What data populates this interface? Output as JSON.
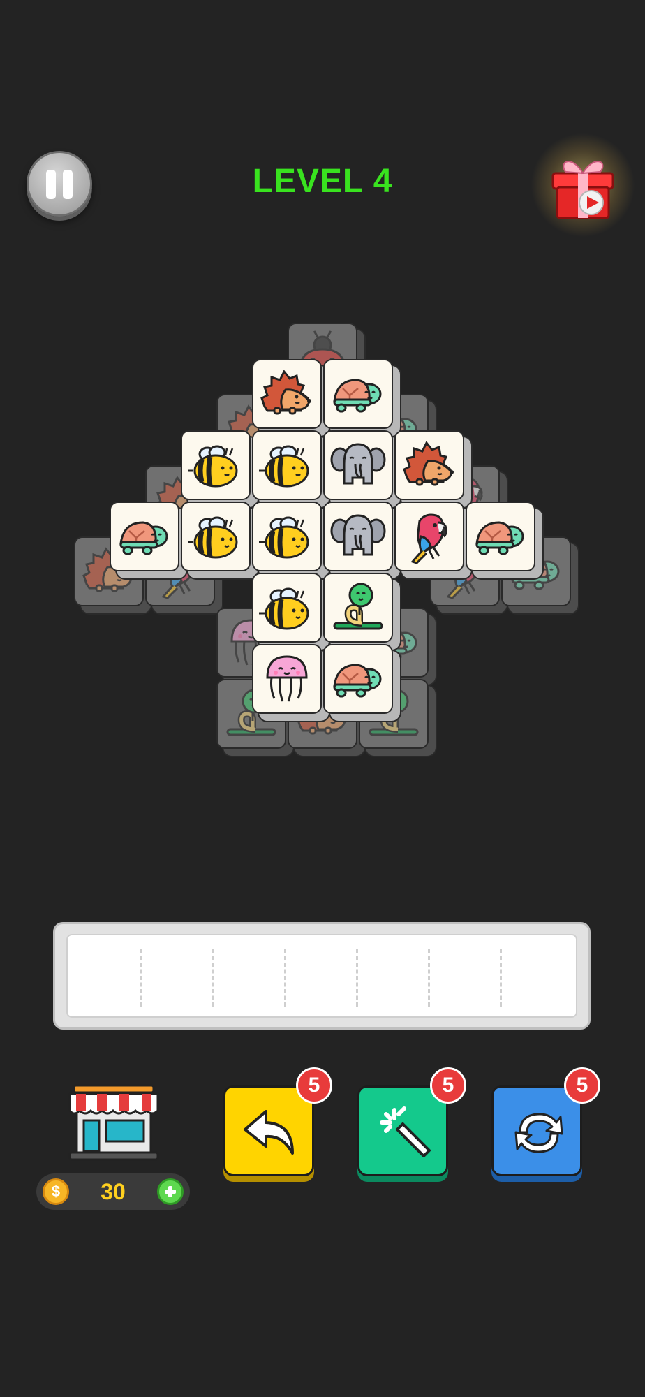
{
  "header": {
    "level_title": "LEVEL 4",
    "pause_icon": "pause-icon",
    "gift_icon": "gift-video-reward-icon"
  },
  "board": {
    "lower_tiles": [
      "ladybug",
      "hedgehog",
      "turtle",
      "hedgehog",
      "parrot",
      "parrot",
      "turtle",
      "jellyfish",
      "turtle",
      "snake",
      "hedgehog",
      "snake"
    ],
    "top_tiles": [
      "hedgehog",
      "turtle",
      "bee",
      "bee",
      "elephant",
      "hedgehog",
      "turtle",
      "bee",
      "bee",
      "elephant",
      "parrot",
      "turtle",
      "bee",
      "snake",
      "jellyfish",
      "turtle"
    ]
  },
  "tray": {
    "slot_count": 7,
    "filled": []
  },
  "shop": {
    "icon": "shop-storefront-icon",
    "coin_icon": "coin-icon",
    "coins": "30",
    "add_icon": "plus-icon"
  },
  "powerups": [
    {
      "name": "undo",
      "icon": "undo-arrow-icon",
      "count": "5",
      "color": "#ffd400"
    },
    {
      "name": "magic",
      "icon": "magic-wand-icon",
      "count": "5",
      "color": "#14c98c"
    },
    {
      "name": "shuffle",
      "icon": "shuffle-refresh-icon",
      "count": "5",
      "color": "#3b8fe8"
    }
  ],
  "colors": {
    "background": "#232323",
    "level_text": "#39e21f",
    "badge": "#e83b3b"
  }
}
